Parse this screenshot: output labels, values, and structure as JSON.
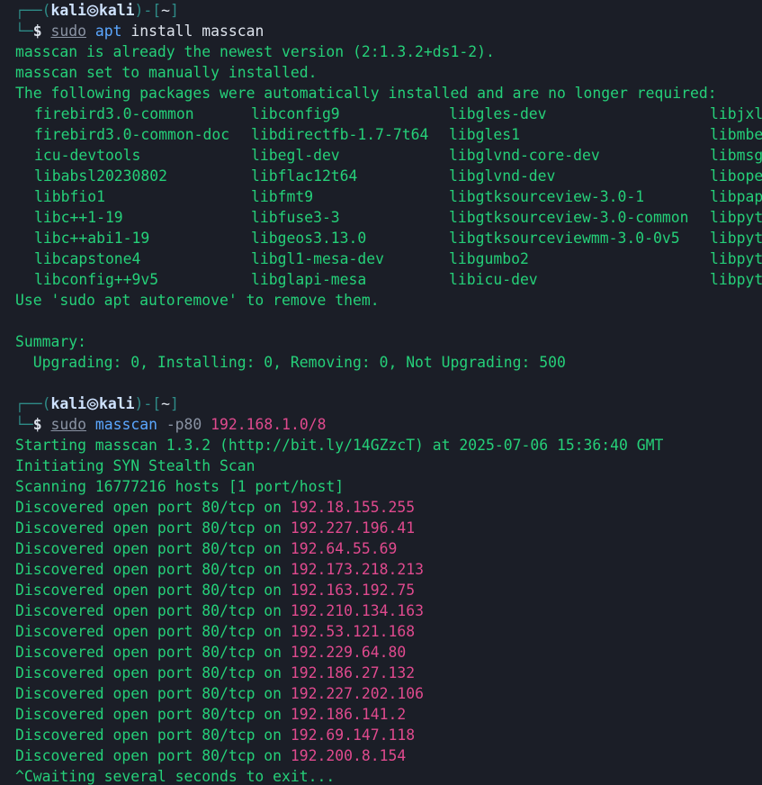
{
  "prompt1": {
    "frame_top": "┌──(",
    "user": "kali",
    "host": "kali",
    "mid": ")-[",
    "dir": "~",
    "end": "]",
    "frame_bottom": "└─",
    "dollar": "$",
    "cmd_sudo": "sudo",
    "cmd_prog": "apt",
    "cmd_args": "install masscan"
  },
  "apt_output": {
    "line1": "masscan is already the newest version (2:1.3.2+ds1-2).",
    "line2": "masscan set to manually installed.",
    "line3": "The following packages were automatically installed and are no longer required:",
    "packages": [
      [
        "firebird3.0-common",
        "libconfig9",
        "libgles-dev",
        "libjxl"
      ],
      [
        "firebird3.0-common-doc",
        "libdirectfb-1.7-7t64",
        "libgles1",
        "libmbe"
      ],
      [
        "icu-devtools",
        "libegl-dev",
        "libglvnd-core-dev",
        "libmsg"
      ],
      [
        "libabsl20230802",
        "libflac12t64",
        "libglvnd-dev",
        "libope"
      ],
      [
        "libbfio1",
        "libfmt9",
        "libgtksourceview-3.0-1",
        "libpap"
      ],
      [
        "libc++1-19",
        "libfuse3-3",
        "libgtksourceview-3.0-common",
        "libpyt"
      ],
      [
        "libc++abi1-19",
        "libgeos3.13.0",
        "libgtksourceviewmm-3.0-0v5",
        "libpyt"
      ],
      [
        "libcapstone4",
        "libgl1-mesa-dev",
        "libgumbo2",
        "libpyt"
      ],
      [
        "libconfig++9v5",
        "libglapi-mesa",
        "libicu-dev",
        "libpyt"
      ]
    ],
    "autoremove": "Use 'sudo apt autoremove' to remove them.",
    "summary_label": "Summary:",
    "summary_line": "  Upgrading: 0, Installing: 0, Removing: 0, Not Upgrading: 500"
  },
  "prompt2": {
    "frame_top": "┌──(",
    "user": "kali",
    "host": "kali",
    "mid": ")-[",
    "dir": "~",
    "end": "]",
    "frame_bottom": "└─",
    "dollar": "$",
    "cmd_sudo": "sudo",
    "cmd_prog": "masscan",
    "cmd_flag": "-p80",
    "cmd_target": "192.168.1.0/8"
  },
  "masscan_output": {
    "start": "Starting masscan 1.3.2 (http://bit.ly/14GZzcT) at 2025-07-06 15:36:40 GMT",
    "initiating": "Initiating SYN Stealth Scan",
    "scanning": "Scanning 16777216 hosts [1 port/host]",
    "discovered_prefix": "Discovered open port 80/tcp on ",
    "ips": [
      "192.18.155.255",
      "192.227.196.41",
      "192.64.55.69",
      "192.173.218.213",
      "192.163.192.75",
      "192.210.134.163",
      "192.53.121.168",
      "192.229.64.80",
      "192.186.27.132",
      "192.227.202.106",
      "192.186.141.2",
      "192.69.147.118",
      "192.200.8.154"
    ],
    "exit": "^Cwaiting several seconds to exit..."
  },
  "colors": {
    "background": "#1b1e27",
    "output_green": "#25d079",
    "frame_teal": "#2e8b87",
    "command_blue": "#5ba7ff",
    "ip_pink": "#e04a8e"
  },
  "icons": {
    "kali_separator": "kali-dragon-icon"
  }
}
